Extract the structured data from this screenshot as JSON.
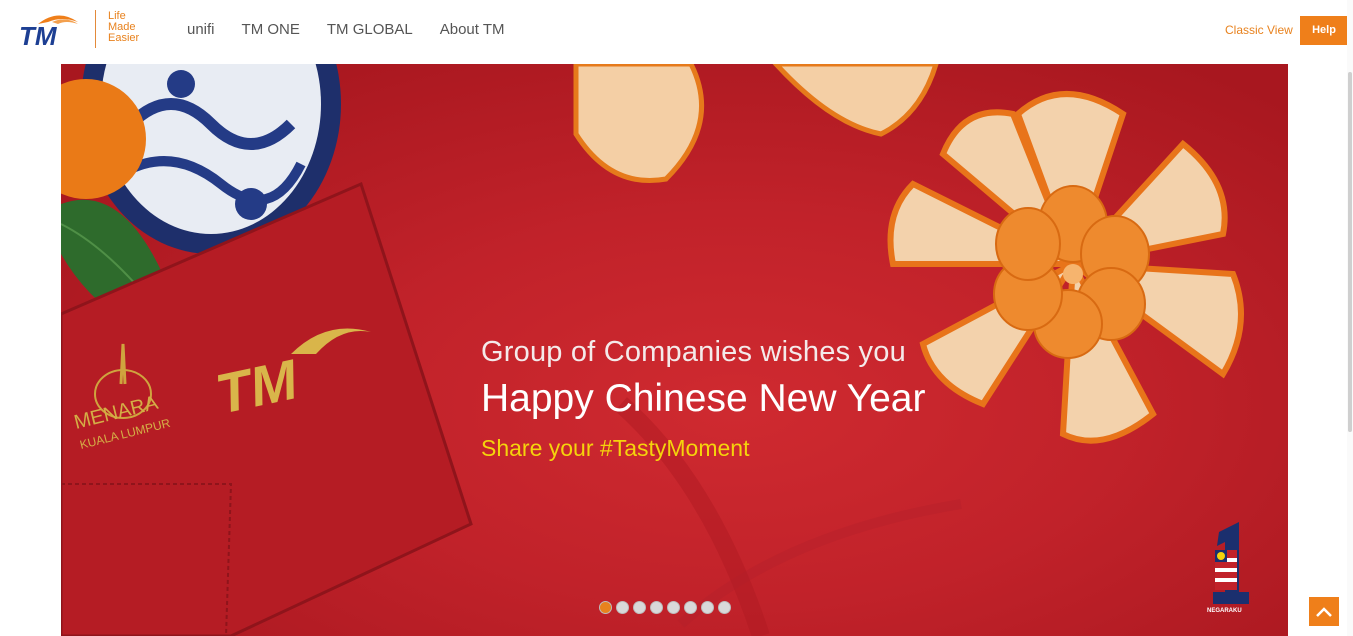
{
  "header": {
    "logo_text": "TM",
    "tagline": [
      "Life",
      "Made",
      "Easier"
    ],
    "nav": [
      "unifi",
      "TM ONE",
      "TM GLOBAL",
      "About TM"
    ],
    "classic_view": "Classic View",
    "help": "Help"
  },
  "banner": {
    "line1": "Group of Companies wishes you",
    "line2": "Happy Chinese New Year",
    "line3": "Share your #TastyMoment",
    "embroidery_logo": "TM",
    "menara_text": "MENARA",
    "menara_sub": "KUALA LUMPUR",
    "badge_text": "NEGARAKU",
    "slide_count": 8,
    "active_slide": 1
  },
  "colors": {
    "brand_orange": "#ef7f1a",
    "banner_red": "#c1222a",
    "accent_yellow": "#f5d30c",
    "logo_blue": "#1d3f93"
  },
  "icons": {
    "back_to_top": "chevron-up-icon"
  }
}
